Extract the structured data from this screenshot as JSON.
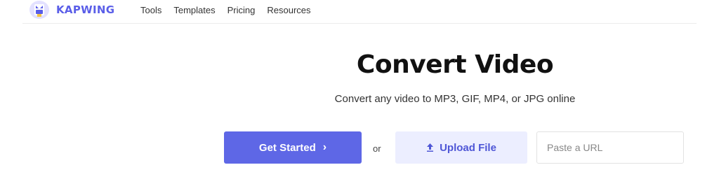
{
  "header": {
    "brand": "KAPWING",
    "logo_icon": "kapwing-logo-icon",
    "nav": [
      {
        "label": "Tools"
      },
      {
        "label": "Templates"
      },
      {
        "label": "Pricing"
      },
      {
        "label": "Resources"
      }
    ]
  },
  "hero": {
    "title": "Convert Video",
    "subtitle": "Convert any video to MP3, GIF, MP4, or JPG online"
  },
  "actions": {
    "get_started_label": "Get Started",
    "get_started_icon": "chevron-right-icon",
    "or_label": "or",
    "upload_label": "Upload File",
    "upload_icon": "upload-icon",
    "url_placeholder": "Paste a URL"
  },
  "colors": {
    "brand": "#5a5ee8",
    "primary_button": "#5e67e6",
    "upload_button_bg": "#eceeff"
  }
}
